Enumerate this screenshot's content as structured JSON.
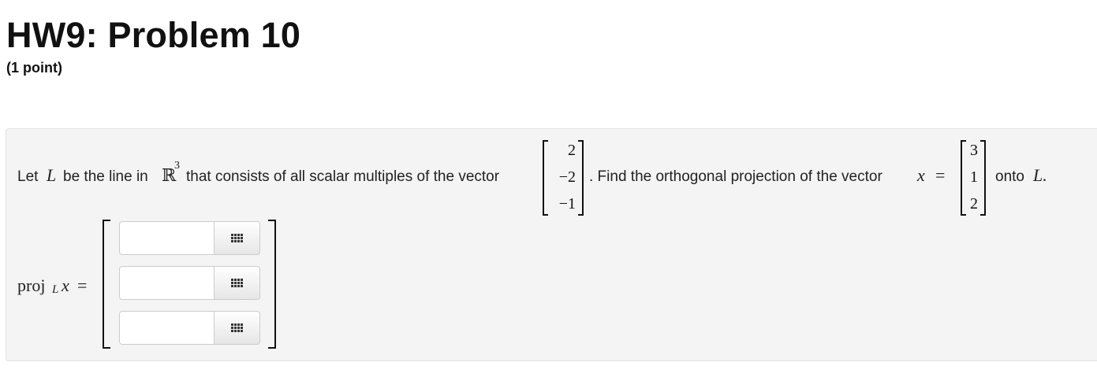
{
  "header": {
    "title": "HW9: Problem 10",
    "points": "(1 point)"
  },
  "problem": {
    "text_let": "Let",
    "var_L": "L",
    "text_line_in": "be the line in",
    "space_R": "ℝ",
    "space_exp": "3",
    "text_consists": "that consists of all scalar multiples of the vector",
    "direction_vector": [
      "2",
      "−2",
      "−1"
    ],
    "text_find": ". Find the orthogonal projection of the vector",
    "var_x": "x⃗",
    "equals": "=",
    "x_vector": [
      "3",
      "1",
      "2"
    ],
    "text_onto": "onto",
    "var_L_end": "L."
  },
  "answer": {
    "label_proj": "proj",
    "label_sub": "L",
    "label_x": "x⃗",
    "label_eq": "=",
    "entries": [
      {
        "value": "",
        "button_icon": "grid-icon"
      },
      {
        "value": "",
        "button_icon": "grid-icon"
      },
      {
        "value": "",
        "button_icon": "grid-icon"
      }
    ]
  }
}
